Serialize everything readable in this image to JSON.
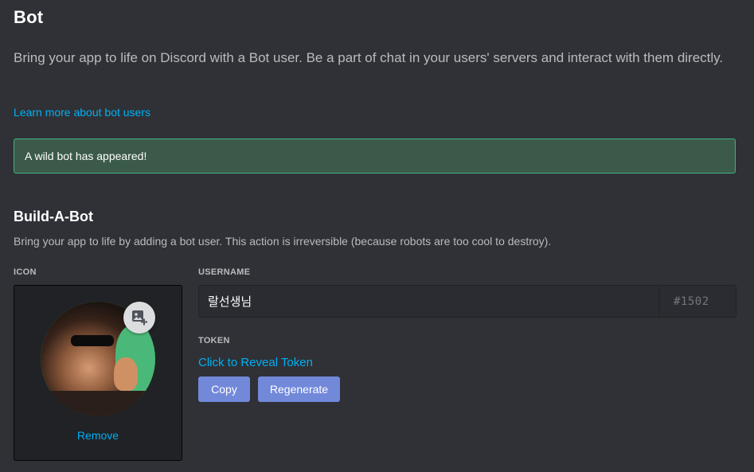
{
  "page": {
    "title": "Bot",
    "description": "Bring your app to life on Discord with a Bot user. Be a part of chat in your users' servers and interact with them directly.",
    "learn_more_link": "Learn more about bot users",
    "success_message": "A wild bot has appeared!"
  },
  "build_a_bot": {
    "title": "Build-A-Bot",
    "description": "Bring your app to life by adding a bot user. This action is irreversible (because robots are too cool to destroy).",
    "icon": {
      "label": "ICON",
      "remove_label": "Remove",
      "upload_icon": "image-add-icon"
    },
    "username": {
      "label": "USERNAME",
      "value": "랄선생님",
      "discriminator": "#1502"
    },
    "token": {
      "label": "TOKEN",
      "reveal_link": "Click to Reveal Token",
      "copy_button": "Copy",
      "regenerate_button": "Regenerate"
    }
  },
  "colors": {
    "background": "#2f3136",
    "link": "#00b0f4",
    "success_bg": "#3b5a4a",
    "success_border": "#43b581",
    "button": "#7289da"
  }
}
